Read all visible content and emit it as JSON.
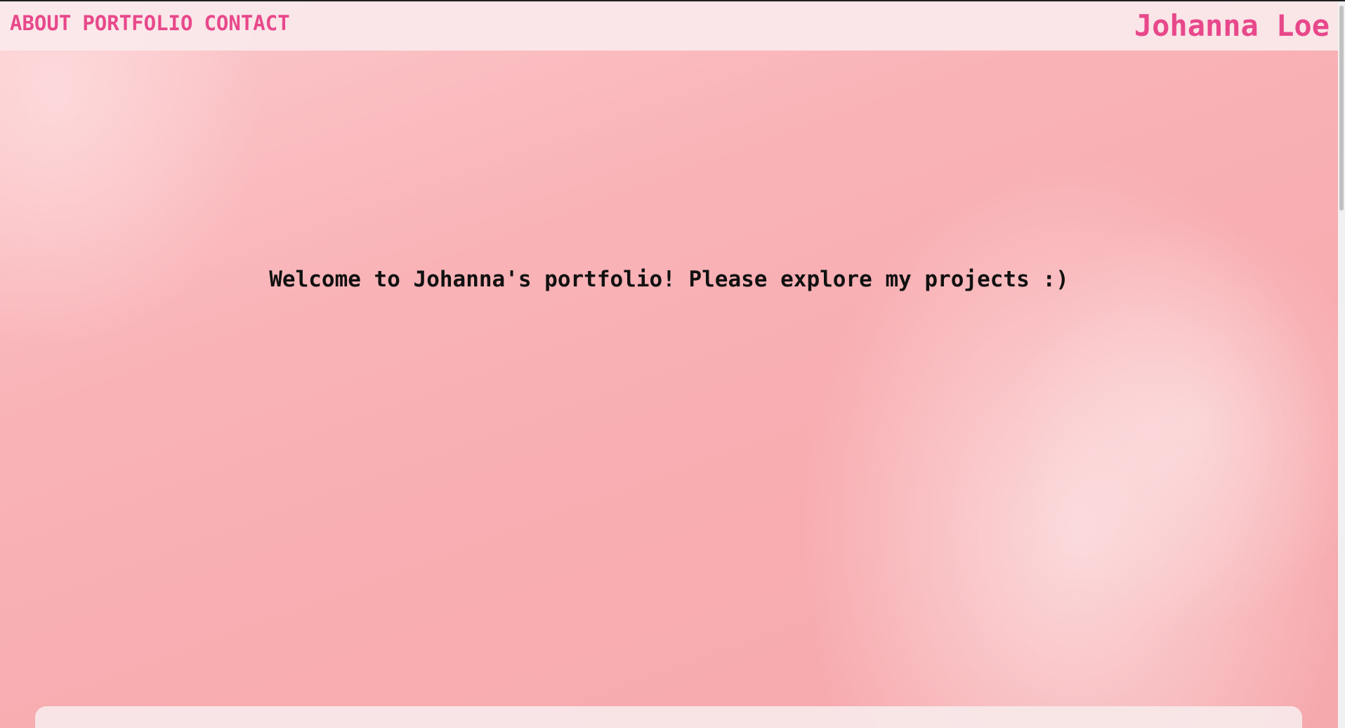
{
  "nav": {
    "links": [
      "ABOUT",
      "PORTFOLIO",
      "CONTACT"
    ],
    "brand": "Johanna Loe"
  },
  "hero": {
    "welcome_text": "Welcome to Johanna's portfolio! Please explore my projects :)"
  },
  "colors": {
    "accent": "#e8488b",
    "background": "#f8adb1",
    "navbar": "#fae9eb",
    "text": "#111111"
  }
}
